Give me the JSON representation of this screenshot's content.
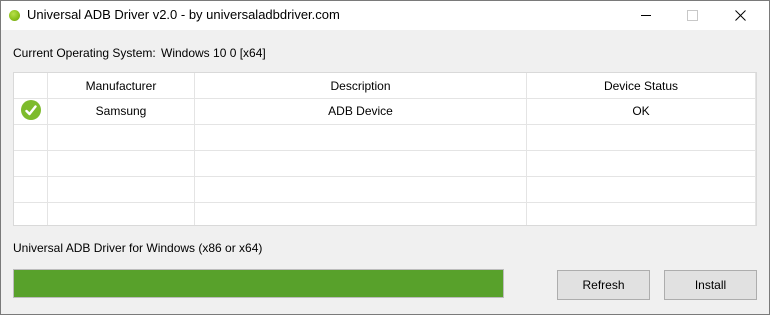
{
  "window": {
    "title": "Universal ADB Driver v2.0 - by universaladbdriver.com",
    "icon": "green-ball-icon"
  },
  "os": {
    "label": "Current Operating System:",
    "value": "Windows 10 0 [x64]"
  },
  "table": {
    "columns": [
      "Manufacturer",
      "Description",
      "Device Status"
    ],
    "rows": [
      {
        "status_icon": "check-icon",
        "manufacturer": "Samsung",
        "description": "ADB Device",
        "device_status": "OK"
      }
    ]
  },
  "driver_label": "Universal ADB Driver for Windows (x86 or x64)",
  "progress": {
    "percent": 100,
    "color": "#58a12b"
  },
  "buttons": {
    "refresh": "Refresh",
    "install": "Install"
  }
}
